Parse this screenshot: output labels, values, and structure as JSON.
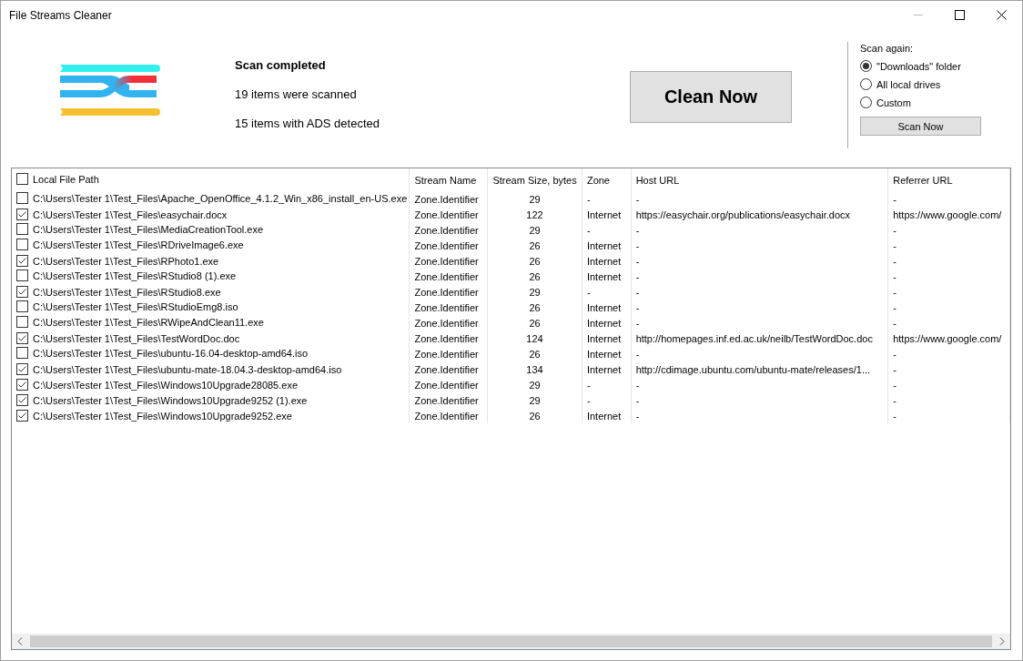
{
  "window": {
    "title": "File Streams Cleaner"
  },
  "summary": {
    "heading": "Scan completed",
    "scanned": "19 items were scanned",
    "detected": "15 items with ADS detected"
  },
  "clean_button": "Clean Now",
  "scan_again": {
    "label": "Scan again:",
    "options": [
      {
        "label": "\"Downloads\" folder",
        "selected": true
      },
      {
        "label": "All local drives",
        "selected": false
      },
      {
        "label": "Custom",
        "selected": false
      }
    ],
    "button": "Scan Now"
  },
  "table": {
    "select_all_checked": false,
    "columns": [
      "Local File Path",
      "Stream Name",
      "Stream Size, bytes",
      "Zone",
      "Host URL",
      "Referrer URL"
    ],
    "rows": [
      {
        "checked": false,
        "path": "C:\\Users\\Tester 1\\Test_Files\\Apache_OpenOffice_4.1.2_Win_x86_install_en-US.exe",
        "stream": "Zone.Identifier",
        "size": "29",
        "zone": "-",
        "host": "-",
        "referrer": "-"
      },
      {
        "checked": true,
        "path": "C:\\Users\\Tester 1\\Test_Files\\easychair.docx",
        "stream": "Zone.Identifier",
        "size": "122",
        "zone": "Internet",
        "host": "https://easychair.org/publications/easychair.docx",
        "referrer": "https://www.google.com/"
      },
      {
        "checked": false,
        "path": "C:\\Users\\Tester 1\\Test_Files\\MediaCreationTool.exe",
        "stream": "Zone.Identifier",
        "size": "29",
        "zone": "-",
        "host": "-",
        "referrer": "-"
      },
      {
        "checked": false,
        "path": "C:\\Users\\Tester 1\\Test_Files\\RDriveImage6.exe",
        "stream": "Zone.Identifier",
        "size": "26",
        "zone": "Internet",
        "host": "-",
        "referrer": "-"
      },
      {
        "checked": true,
        "path": "C:\\Users\\Tester 1\\Test_Files\\RPhoto1.exe",
        "stream": "Zone.Identifier",
        "size": "26",
        "zone": "Internet",
        "host": "-",
        "referrer": "-"
      },
      {
        "checked": false,
        "path": "C:\\Users\\Tester 1\\Test_Files\\RStudio8 (1).exe",
        "stream": "Zone.Identifier",
        "size": "26",
        "zone": "Internet",
        "host": "-",
        "referrer": "-"
      },
      {
        "checked": true,
        "path": "C:\\Users\\Tester 1\\Test_Files\\RStudio8.exe",
        "stream": "Zone.Identifier",
        "size": "29",
        "zone": "-",
        "host": "-",
        "referrer": "-"
      },
      {
        "checked": false,
        "path": "C:\\Users\\Tester 1\\Test_Files\\RStudioEmg8.iso",
        "stream": "Zone.Identifier",
        "size": "26",
        "zone": "Internet",
        "host": "-",
        "referrer": "-"
      },
      {
        "checked": false,
        "path": "C:\\Users\\Tester 1\\Test_Files\\RWipeAndClean11.exe",
        "stream": "Zone.Identifier",
        "size": "26",
        "zone": "Internet",
        "host": "-",
        "referrer": "-"
      },
      {
        "checked": true,
        "path": "C:\\Users\\Tester 1\\Test_Files\\TestWordDoc.doc",
        "stream": "Zone.Identifier",
        "size": "124",
        "zone": "Internet",
        "host": "http://homepages.inf.ed.ac.uk/neilb/TestWordDoc.doc",
        "referrer": "https://www.google.com/"
      },
      {
        "checked": false,
        "path": "C:\\Users\\Tester 1\\Test_Files\\ubuntu-16.04-desktop-amd64.iso",
        "stream": "Zone.Identifier",
        "size": "26",
        "zone": "Internet",
        "host": "-",
        "referrer": "-"
      },
      {
        "checked": true,
        "path": "C:\\Users\\Tester 1\\Test_Files\\ubuntu-mate-18.04.3-desktop-amd64.iso",
        "stream": "Zone.Identifier",
        "size": "134",
        "zone": "Internet",
        "host": "http://cdimage.ubuntu.com/ubuntu-mate/releases/1...",
        "referrer": "-"
      },
      {
        "checked": true,
        "path": "C:\\Users\\Tester 1\\Test_Files\\Windows10Upgrade28085.exe",
        "stream": "Zone.Identifier",
        "size": "29",
        "zone": "-",
        "host": "-",
        "referrer": "-"
      },
      {
        "checked": true,
        "path": "C:\\Users\\Tester 1\\Test_Files\\Windows10Upgrade9252 (1).exe",
        "stream": "Zone.Identifier",
        "size": "29",
        "zone": "-",
        "host": "-",
        "referrer": "-"
      },
      {
        "checked": true,
        "path": "C:\\Users\\Tester 1\\Test_Files\\Windows10Upgrade9252.exe",
        "stream": "Zone.Identifier",
        "size": "26",
        "zone": "Internet",
        "host": "-",
        "referrer": "-"
      }
    ]
  }
}
